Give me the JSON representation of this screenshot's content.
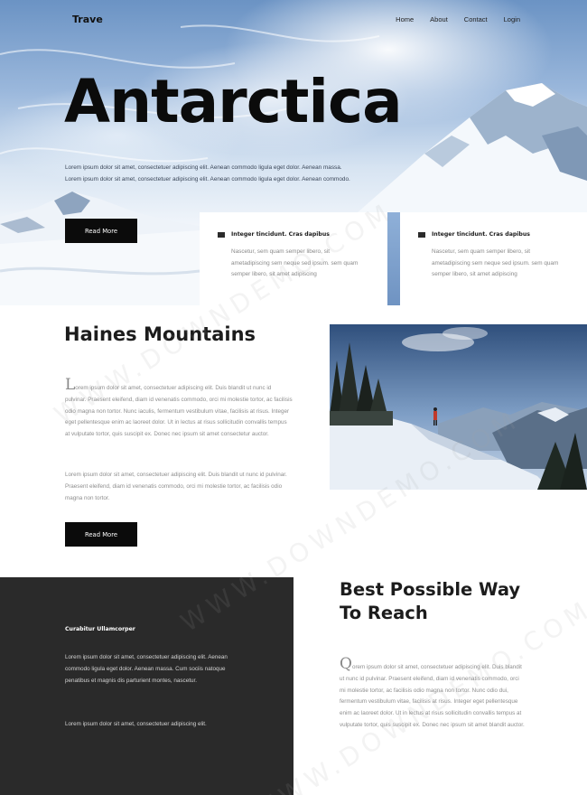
{
  "nav": {
    "logo": "Trave",
    "links": [
      "Home",
      "About",
      "Contact",
      "Login"
    ]
  },
  "hero": {
    "title": "Antarctica",
    "text": "Lorem ipsum dolor sit amet, consectetuer adipiscing elit. Aenean commodo ligula eget dolor. Aenean massa. Lorem ipsum dolor sit amet, consectetuer adipiscing elit. Aenean commodo ligula eget dolor. Aenean commodo.",
    "button": "Read More",
    "cards": [
      {
        "title": "Integer tincidunt. Cras dapibus",
        "body": [
          "Nascetur, sem quam semper libero, sit",
          "ametadipiscing sem neque sed ipsum. sem quam",
          "semper libero, sit amet adipiscing"
        ]
      },
      {
        "title": "Integer tincidunt. Cras dapibus",
        "body": [
          "Nascetur, sem quam semper libero, sit",
          "ametadipiscing sem neque sed ipsum. sem quam",
          "semper libero, sit amet adipiscing"
        ]
      }
    ]
  },
  "section2": {
    "title": "Haines Mountains",
    "dropcap": "L",
    "para1": "orem ipsum dolor sit amet, consectetuer adipiscing elit. Duis blandit ut nunc id pulvinar. Praesent eleifend, diam id venenatis commodo, orci mi molestie tortor, ac facilisis odio magna non tortor. Nunc iaculis, fermentum vestibulum vitae, facilisis at risus. Integer eget pellentesque enim ac laoreet dolor. Ut in lectus at risus sollicitudin convallis tempus at vulputate tortor, quis suscipit ex. Donec nec ipsum sit amet consectetur auctor.",
    "para2": "Lorem ipsum dolor sit amet, consectetuer adipiscing elit. Duis blandit ut nunc id pulvinar. Praesent eleifend, diam id venenatis commodo, orci mi molestie tortor, ac facilisis odio magna non tortor.",
    "button": "Read More"
  },
  "section3": {
    "dark_title": "Curabitur Ullamcorper",
    "dark_p1": "Lorem ipsum dolor sit amet, consectetuer adipiscing elit. Aenean commodo ligula eget dolor. Aenean massa. Cum sociis natoque penatibus et magnis dis parturient montes, nascetur.",
    "dark_p2": "Lorem ipsum dolor sit amet, consectetuer adipiscing elit.",
    "title_line1": "Best Possible Way",
    "title_line2": "To Reach",
    "dropcap": "Q",
    "para": "orem ipsum dolor sit amet, consectetuer adipiscing elit. Duis blandit ut nunc id pulvinar. Praesent eleifend, diam id venenatis commodo, orci mi molestie tortor, ac facilisis odio magna non tortor. Nunc odio dui, fermentum vestibulum vitae, facilisis at risus. Integer eget pellentesque enim ac laoreet dolor. Ut in lectus at risus sollicitudin convallis tempus at vulputate tortor, quis suscipit ex. Donec nec ipsum sit amet blandit auctor."
  },
  "watermark": "WWW.DOWNDEMO.COM"
}
